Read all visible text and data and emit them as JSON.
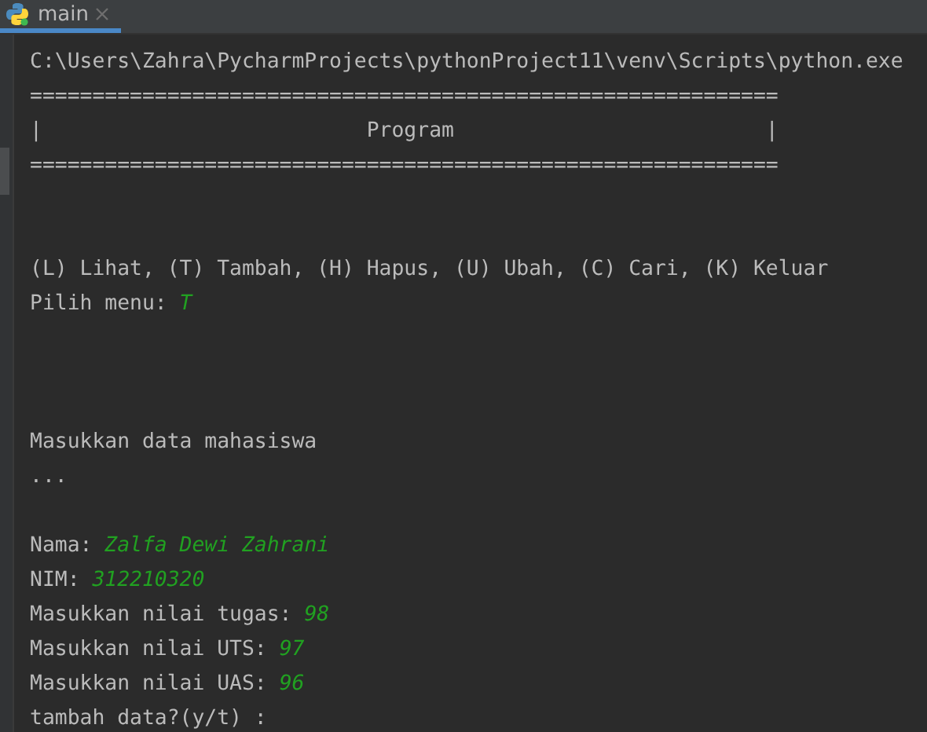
{
  "tabs": [
    {
      "label": "main",
      "selected": true
    }
  ],
  "console": {
    "lines": [
      {
        "kind": "text",
        "text": "C:\\Users\\Zahra\\PycharmProjects\\pythonProject11\\venv\\Scripts\\python.exe"
      },
      {
        "kind": "text",
        "text": "============================================================"
      },
      {
        "kind": "text",
        "text": "|                          Program                         |"
      },
      {
        "kind": "text",
        "text": "============================================================"
      },
      {
        "kind": "blank"
      },
      {
        "kind": "blank"
      },
      {
        "kind": "text",
        "text": "(L) Lihat, (T) Tambah, (H) Hapus, (U) Ubah, (C) Cari, (K) Keluar"
      },
      {
        "kind": "prompt",
        "label": "Pilih menu:",
        "input": "T"
      },
      {
        "kind": "blank"
      },
      {
        "kind": "blank"
      },
      {
        "kind": "blank"
      },
      {
        "kind": "text",
        "text": "Masukkan data mahasiswa"
      },
      {
        "kind": "text",
        "text": "..."
      },
      {
        "kind": "blank"
      },
      {
        "kind": "prompt",
        "label": "Nama:",
        "input": "Zalfa Dewi Zahrani"
      },
      {
        "kind": "prompt",
        "label": "NIM:",
        "input": "312210320"
      },
      {
        "kind": "prompt",
        "label": "Masukkan nilai tugas:",
        "input": "98"
      },
      {
        "kind": "prompt",
        "label": "Masukkan nilai UTS:",
        "input": "97"
      },
      {
        "kind": "prompt",
        "label": "Masukkan nilai UAS:",
        "input": "96"
      },
      {
        "kind": "text",
        "text": "tambah data?(y/t) :"
      }
    ]
  }
}
